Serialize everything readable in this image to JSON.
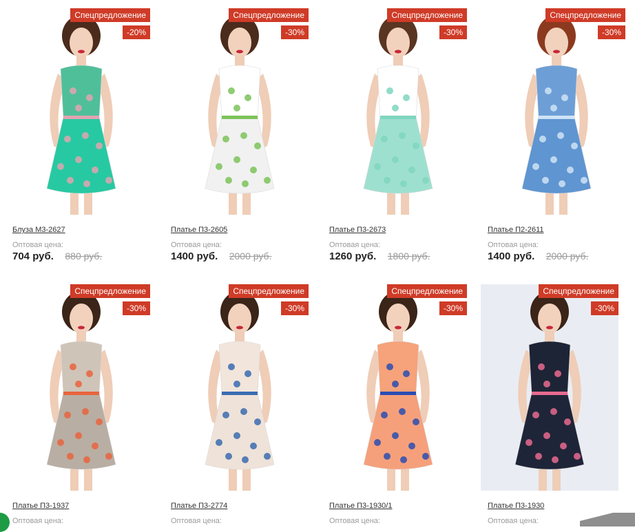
{
  "products": [
    {
      "name": "Блуза М3-2627",
      "offer": "Спецпредложение",
      "discount": "-20%",
      "price_label": "Оптовая цена:",
      "price": "704 руб.",
      "old_price": "880 руб.",
      "colors": {
        "top": "#4fbf9a",
        "pattern": "#e1a4b0",
        "bottom": "#27c9a2",
        "hair": "#4a2b1c"
      }
    },
    {
      "name": "Платье П3-2605",
      "offer": "Спецпредложение",
      "discount": "-30%",
      "price_label": "Оптовая цена:",
      "price": "1400 руб.",
      "old_price": "2000 руб.",
      "colors": {
        "top": "#ffffff",
        "pattern": "#7cc35a",
        "bottom": "#f1f1f1",
        "hair": "#4a2b1c"
      }
    },
    {
      "name": "Платье П3-2673",
      "offer": "Спецпредложение",
      "discount": "-30%",
      "price_label": "Оптовая цена:",
      "price": "1260 руб.",
      "old_price": "1800 руб.",
      "colors": {
        "top": "#ffffff",
        "pattern": "#7fd6c0",
        "bottom": "#9ee0cf",
        "hair": "#5a3522"
      }
    },
    {
      "name": "Платье П2-2611",
      "offer": "Спецпредложение",
      "discount": "-30%",
      "price_label": "Оптовая цена:",
      "price": "1400 руб.",
      "old_price": "2000 руб.",
      "colors": {
        "top": "#6d9fd6",
        "pattern": "#cfe3f6",
        "bottom": "#5f95d1",
        "hair": "#8c3a1f"
      }
    },
    {
      "name": "Платье П3-1937",
      "offer": "Спецпредложение",
      "discount": "-30%",
      "price_label": "Оптовая цена:",
      "price": "",
      "old_price": "",
      "colors": {
        "top": "#cfc4b8",
        "pattern": "#e8643e",
        "bottom": "#b9aea3",
        "hair": "#3b2418"
      }
    },
    {
      "name": "Платье П3-2774",
      "offer": "Спецпредложение",
      "discount": "-30%",
      "price_label": "Оптовая цена:",
      "price": "",
      "old_price": "",
      "colors": {
        "top": "#f1e5dc",
        "pattern": "#3a6cb0",
        "bottom": "#efe2d8",
        "hair": "#3b2418"
      }
    },
    {
      "name": "Платье П3-1930/1",
      "offer": "Спецпредложение",
      "discount": "-30%",
      "price_label": "Оптовая цена:",
      "price": "",
      "old_price": "",
      "colors": {
        "top": "#f6a27a",
        "pattern": "#2a4db2",
        "bottom": "#f5a07b",
        "hair": "#3b2418"
      }
    },
    {
      "name": "Платье П3-1930",
      "offer": "Спецпредложение",
      "discount": "-30%",
      "price_label": "Оптовая цена:",
      "price": "",
      "old_price": "",
      "colors": {
        "top": "#1d2436",
        "pattern": "#e76a8f",
        "bottom": "#1f2538",
        "hair": "#3b2418",
        "background": "#e9edf3"
      }
    }
  ]
}
